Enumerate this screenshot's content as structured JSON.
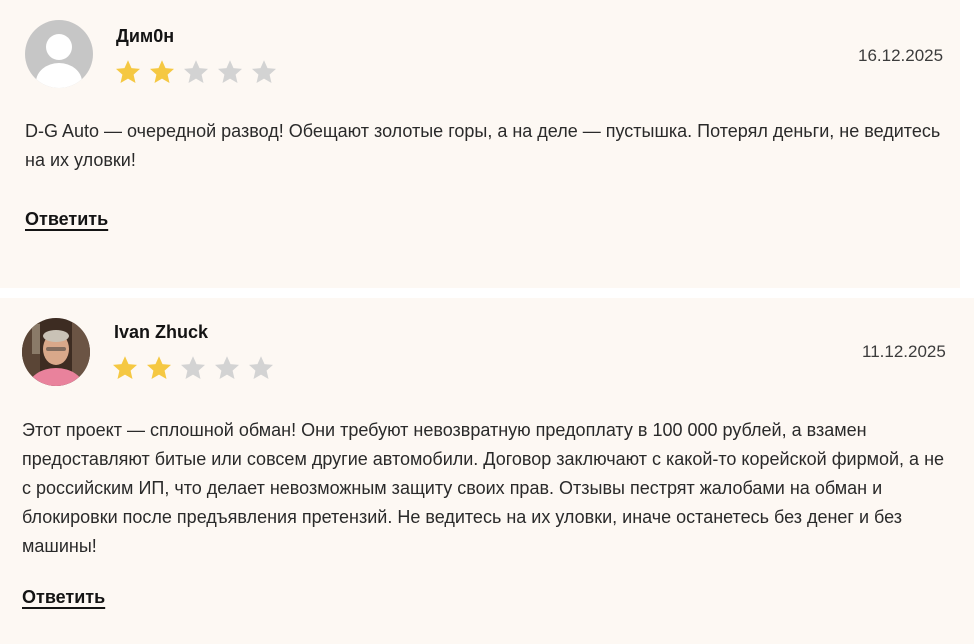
{
  "reviews": [
    {
      "author": "Дим0н",
      "avatar_icon": "default-user-avatar-icon",
      "rating": 2,
      "max_rating": 5,
      "date": "16.12.2025",
      "text": "D-G Auto — очередной развод! Обещают золотые горы, а на деле — пустышка. Потерял деньги, не ведитесь на их уловки!",
      "reply_label": "Ответить"
    },
    {
      "author": "Ivan Zhuck",
      "avatar_icon": "user-photo-avatar",
      "rating": 2,
      "max_rating": 5,
      "date": "11.12.2025",
      "text": "Этот проект — сплошной обман! Они требуют невозвратную предоплату в 100 000 рублей, а взамен предоставляют битые или совсем другие автомобили. Договор заключают с какой-то корейской фирмой, а не с российским ИП, что делает невозможным защиту своих прав. Отзывы пестрят жалобами на обман и блокировки после предъявления претензий. Не ведитесь на их уловки, иначе останетесь без денег и без машины!",
      "reply_label": "Ответить"
    }
  ],
  "colors": {
    "card_background": "#fdf8f3",
    "star_filled": "#f5c842",
    "star_empty": "#d3d3d3",
    "text": "#2a2a2a"
  }
}
